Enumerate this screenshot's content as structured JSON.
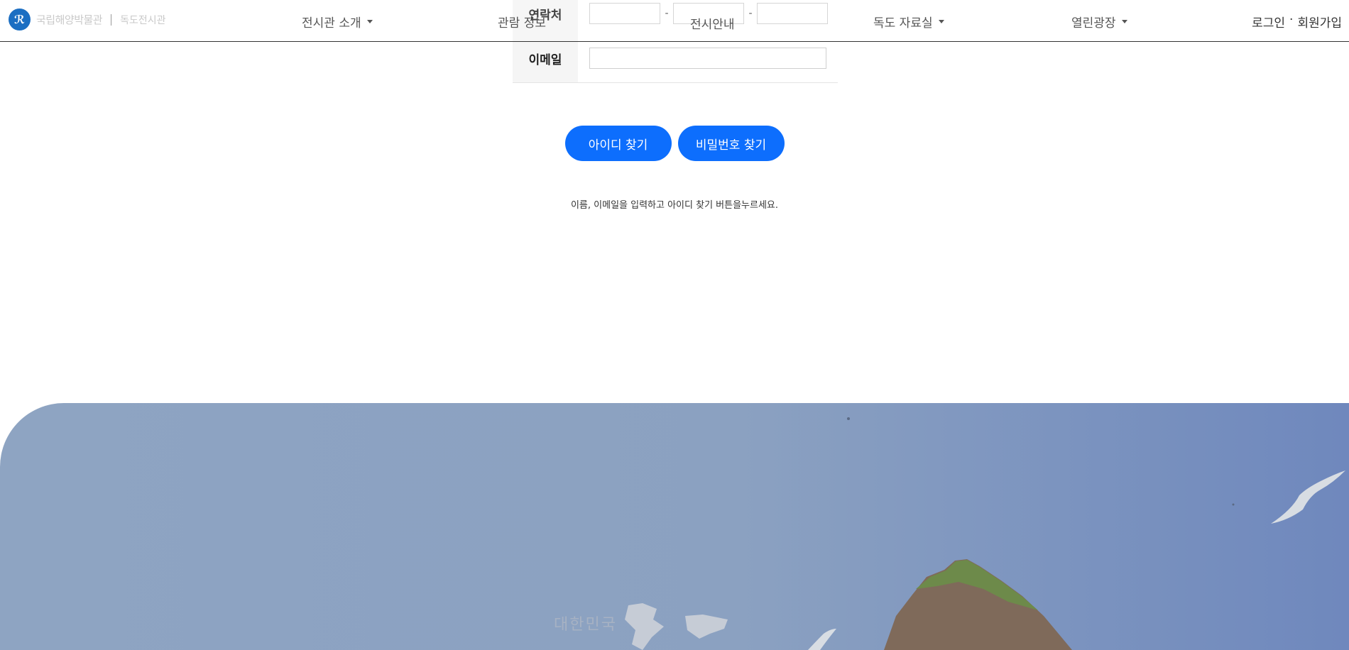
{
  "header": {
    "logo_text": "국립해양박물관",
    "logo_sub": "독도전시관",
    "nav": [
      {
        "label": "전시관 소개"
      },
      {
        "label": "관람 정보"
      },
      {
        "label": "독도 자료실"
      },
      {
        "label": "열린광장"
      }
    ],
    "overlay_label": "전시안내",
    "auth": {
      "login": "로그인",
      "separator": "·",
      "signup": "회원가입"
    }
  },
  "form": {
    "phone_label": "연락처",
    "phone_dash": "-",
    "email_label": "이메일",
    "phone_1": "",
    "phone_2": "",
    "phone_3": "",
    "email": ""
  },
  "buttons": {
    "find_id": "아이디 찾기",
    "find_pw": "비밀번호 찾기"
  },
  "help_text": "이름, 이메일을 입력하고 아이디 찾기 버튼을누르세요.",
  "hero": {
    "caption": "대한민국",
    "colors": {
      "sky": "#8ba1c1",
      "rock": "#7f6a5a",
      "grass": "#6d8a4a"
    }
  }
}
